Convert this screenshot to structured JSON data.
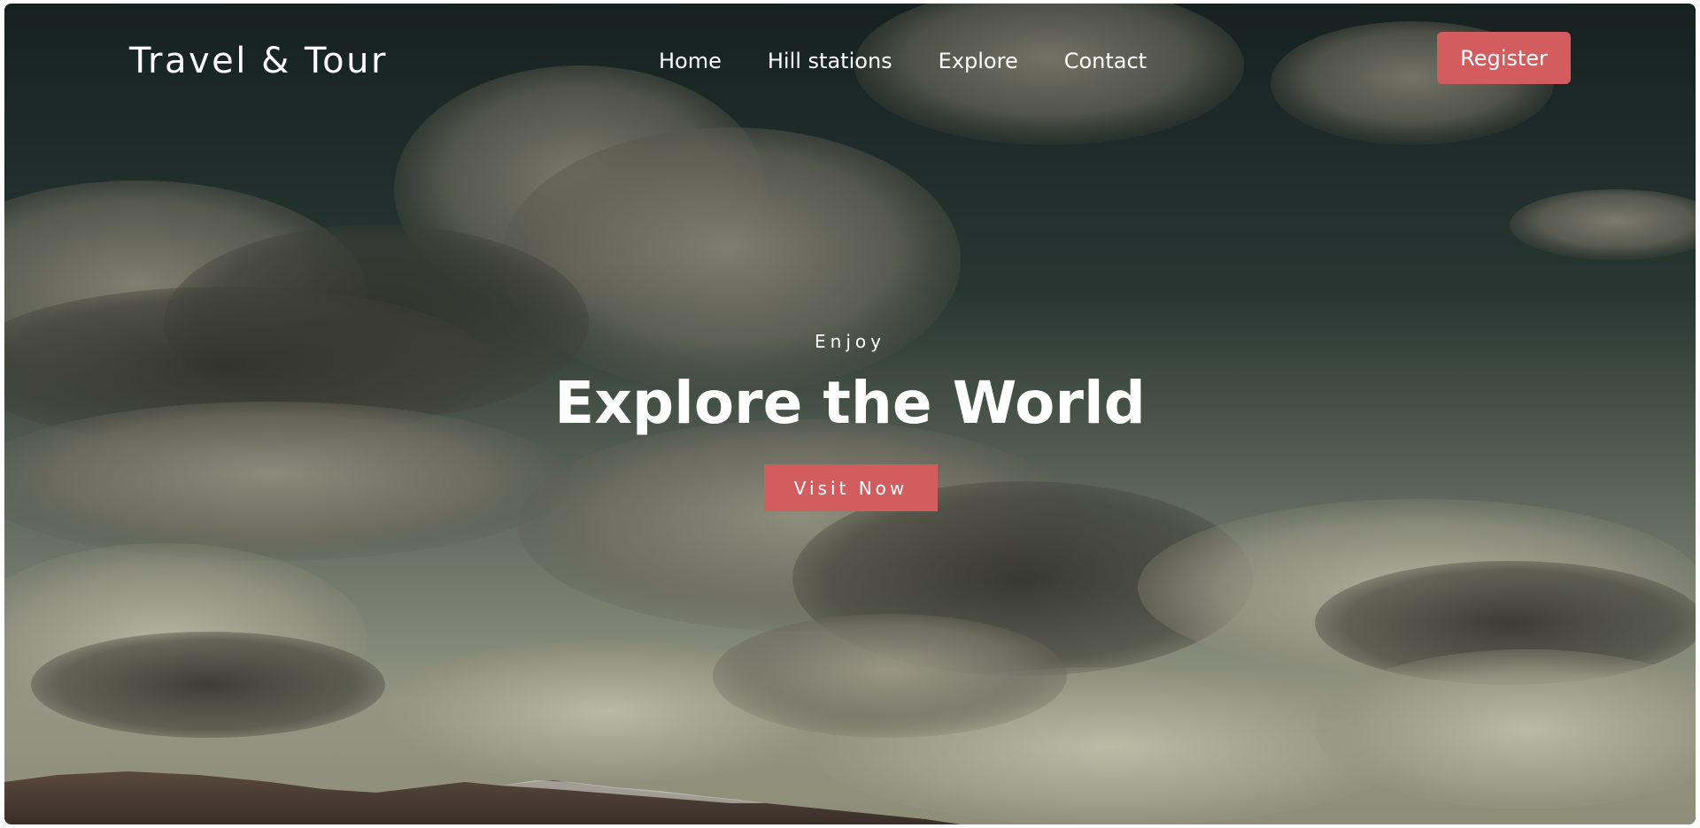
{
  "navbar": {
    "logo": "Travel & Tour",
    "links": [
      "Home",
      "Hill stations",
      "Explore",
      "Contact"
    ],
    "register_label": "Register"
  },
  "hero": {
    "eyebrow": "Enjoy",
    "headline": "Explore the World",
    "cta_label": "Visit Now",
    "background_image": "cloudy-sky-over-mountains",
    "accent_color": "#d35d5e"
  }
}
